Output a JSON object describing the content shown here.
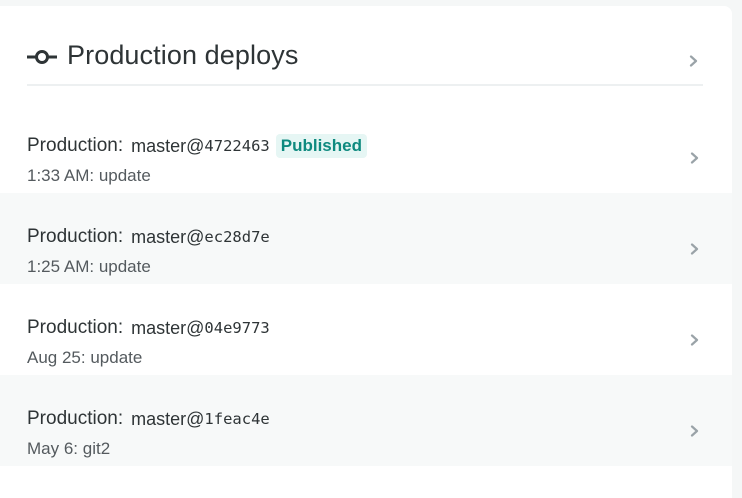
{
  "card": {
    "title": "Production deploys",
    "header_icon": "deploy-commit-icon",
    "header_chevron_icon": "chevron-right-icon"
  },
  "deploys": [
    {
      "context": "Production",
      "colon": ":",
      "branch": "master@",
      "sha": "4722463",
      "badge": "Published",
      "time": "1:33 AM",
      "message": "update",
      "subtitle": "1:33 AM: update",
      "chevron_icon": "chevron-right-icon"
    },
    {
      "context": "Production",
      "colon": ":",
      "branch": "master@",
      "sha": "ec28d7e",
      "badge": null,
      "time": "1:25 AM",
      "message": "update",
      "subtitle": "1:25 AM: update",
      "chevron_icon": "chevron-right-icon"
    },
    {
      "context": "Production",
      "colon": ":",
      "branch": "master@",
      "sha": "04e9773",
      "badge": null,
      "time": "Aug 25",
      "message": "update",
      "subtitle": "Aug 25: update",
      "chevron_icon": "chevron-right-icon"
    },
    {
      "context": "Production",
      "colon": ":",
      "branch": "master@",
      "sha": "1feac4e",
      "badge": null,
      "time": "May 6",
      "message": "git2",
      "subtitle": "May 6: git2",
      "chevron_icon": "chevron-right-icon"
    }
  ],
  "colors": {
    "text_primary": "#2e3436",
    "text_secondary": "#545a5e",
    "badge_text": "#0e8a7f",
    "badge_background": "#e6f6f4",
    "alt_row_background": "#f7f9f9",
    "chevron": "#9aa3a8"
  }
}
